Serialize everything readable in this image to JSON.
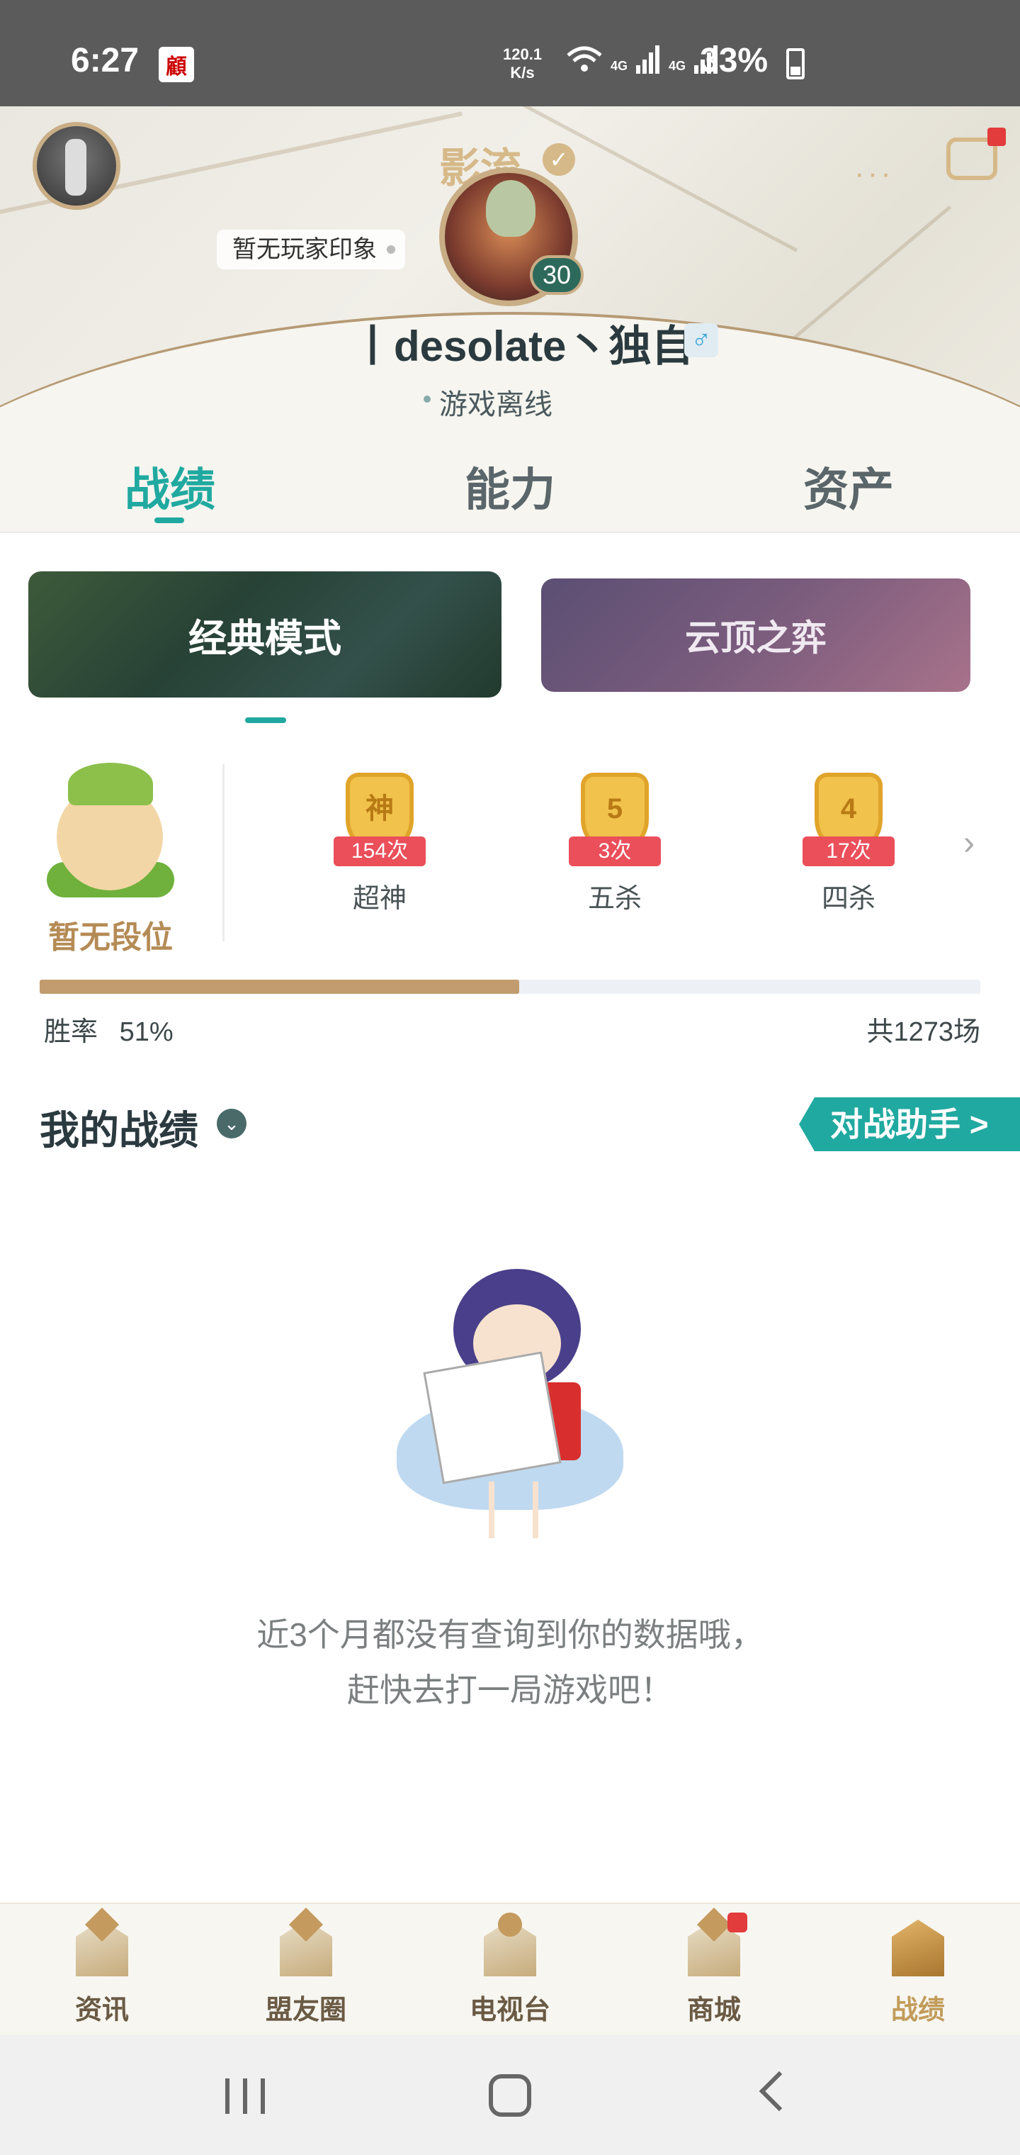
{
  "status_bar": {
    "time": "6:27",
    "app_icon_glyph": "顧",
    "net_speed_value": "120.1",
    "net_speed_unit": "K/s",
    "network_labels": [
      "4G",
      "4G"
    ],
    "battery": "33%"
  },
  "profile": {
    "nickname_title": "影流",
    "impression_badge": "暂无玩家印象",
    "level": "30",
    "username": "丨desolate丶独自",
    "gender_symbol": "♂",
    "status": "游戏离线",
    "more_label": "···"
  },
  "tabs": [
    {
      "label": "战绩",
      "active": true
    },
    {
      "label": "能力",
      "active": false
    },
    {
      "label": "资产",
      "active": false
    }
  ],
  "modes": {
    "classic": "经典模式",
    "tft": "云顶之弈"
  },
  "rank": {
    "label": "暂无段位"
  },
  "badges": [
    {
      "glyph": "神",
      "count": "154次",
      "name": "超神"
    },
    {
      "glyph": "5",
      "count": "3次",
      "name": "五杀"
    },
    {
      "glyph": "4",
      "count": "17次",
      "name": "四杀"
    }
  ],
  "winrate": {
    "label": "胜率",
    "value": "51%",
    "fraction": 0.51,
    "total": "共1273场"
  },
  "my_record": {
    "title": "我的战绩",
    "assistant_button": "对战助手 >"
  },
  "empty_state": {
    "line1": "近3个月都没有查询到你的数据哦，",
    "line2": "赶快去打一局游戏吧！"
  },
  "bottom_nav": [
    {
      "label": "资讯",
      "active": false,
      "badge": false
    },
    {
      "label": "盟友圈",
      "active": false,
      "badge": false
    },
    {
      "label": "电视台",
      "active": false,
      "badge": false
    },
    {
      "label": "商城",
      "active": false,
      "badge": true
    },
    {
      "label": "战绩",
      "active": true,
      "badge": false
    }
  ],
  "colors": {
    "accent": "#20a9a0",
    "gold": "#c29c6e",
    "badge_red": "#ea4f5a"
  }
}
